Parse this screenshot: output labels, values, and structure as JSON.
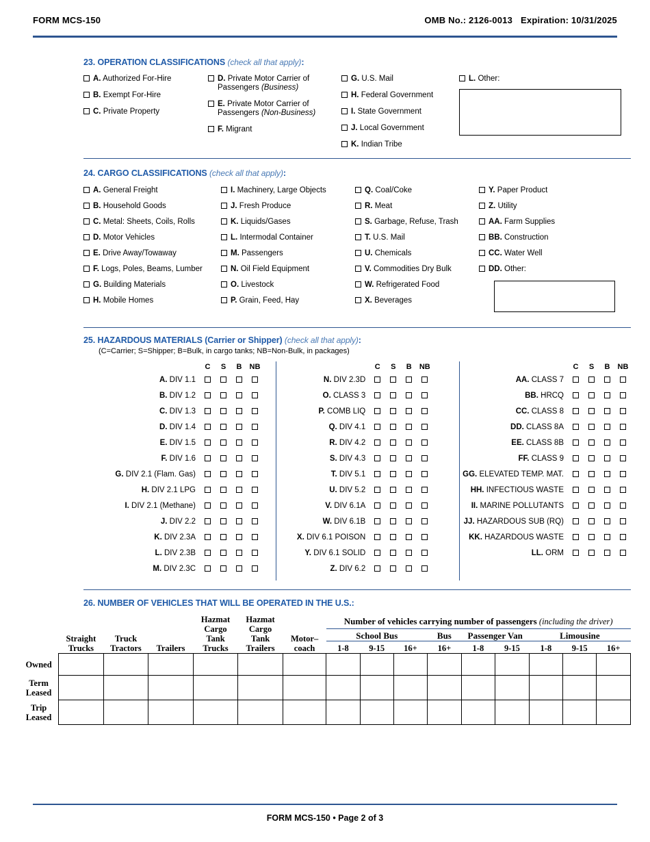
{
  "header": {
    "form_label": "FORM MCS-150",
    "omb": "OMB No.: 2126-0013",
    "expiration": "Expiration: 10/31/2025"
  },
  "footer": {
    "text": "FORM MCS-150 • Page 2 of 3"
  },
  "section23": {
    "number": "23.",
    "title": "OPERATION CLASSIFICATIONS",
    "hint": "(check all that apply)",
    "colon": ":",
    "col1": [
      {
        "letter": "A.",
        "label": "Authorized For-Hire"
      },
      {
        "letter": "B.",
        "label": "Exempt For-Hire"
      },
      {
        "letter": "C.",
        "label": "Private Property"
      }
    ],
    "col2": [
      {
        "letter": "D.",
        "label": "Private Motor Carrier of Passengers ",
        "em": "(Business)"
      },
      {
        "letter": "E.",
        "label": "Private Motor Carrier of Passengers ",
        "em": "(Non-Business)"
      },
      {
        "letter": "F.",
        "label": "Migrant",
        "em": ""
      }
    ],
    "col3": [
      {
        "letter": "G.",
        "label": "U.S. Mail"
      },
      {
        "letter": "H.",
        "label": "Federal Government"
      },
      {
        "letter": "I.",
        "label": "State Government"
      },
      {
        "letter": "J.",
        "label": "Local Government"
      },
      {
        "letter": "K.",
        "label": "Indian Tribe"
      }
    ],
    "other": {
      "letter": "L.",
      "label": "Other:",
      "value": ""
    }
  },
  "section24": {
    "number": "24.",
    "title": "CARGO CLASSIFICATIONS",
    "hint": "(check all that apply)",
    "colon": ":",
    "col1": [
      {
        "letter": "A.",
        "label": "General Freight"
      },
      {
        "letter": "B.",
        "label": "Household Goods"
      },
      {
        "letter": "C.",
        "label": "Metal: Sheets, Coils, Rolls"
      },
      {
        "letter": "D.",
        "label": "Motor Vehicles"
      },
      {
        "letter": "E.",
        "label": "Drive Away/Towaway"
      },
      {
        "letter": "F.",
        "label": "Logs, Poles, Beams, Lumber"
      },
      {
        "letter": "G.",
        "label": "Building Materials"
      },
      {
        "letter": "H.",
        "label": "Mobile Homes"
      }
    ],
    "col2": [
      {
        "letter": "I.",
        "label": "Machinery, Large Objects"
      },
      {
        "letter": "J.",
        "label": "Fresh Produce"
      },
      {
        "letter": "K.",
        "label": "Liquids/Gases"
      },
      {
        "letter": "L.",
        "label": "Intermodal Container"
      },
      {
        "letter": "M.",
        "label": "Passengers"
      },
      {
        "letter": "N.",
        "label": "Oil Field Equipment"
      },
      {
        "letter": "O.",
        "label": "Livestock"
      },
      {
        "letter": "P.",
        "label": "Grain, Feed, Hay"
      }
    ],
    "col3": [
      {
        "letter": "Q.",
        "label": "Coal/Coke"
      },
      {
        "letter": "R.",
        "label": "Meat"
      },
      {
        "letter": "S.",
        "label": "Garbage, Refuse, Trash"
      },
      {
        "letter": "T.",
        "label": "U.S. Mail"
      },
      {
        "letter": "U.",
        "label": "Chemicals"
      },
      {
        "letter": "V.",
        "label": "Commodities Dry Bulk"
      },
      {
        "letter": "W.",
        "label": "Refrigerated Food"
      },
      {
        "letter": "X.",
        "label": "Beverages"
      }
    ],
    "col4": [
      {
        "letter": "Y.",
        "label": "Paper Product"
      },
      {
        "letter": "Z.",
        "label": "Utility"
      },
      {
        "letter": "AA.",
        "label": "Farm Supplies"
      },
      {
        "letter": "BB.",
        "label": "Construction"
      },
      {
        "letter": "CC.",
        "label": "Water Well"
      },
      {
        "letter": "DD.",
        "label": "Other:"
      }
    ],
    "other_value": ""
  },
  "section25": {
    "number": "25.",
    "title": "HAZARDOUS MATERIALS (Carrier or Shipper)",
    "hint": "(check all that apply)",
    "colon": ":",
    "legend": "(C=Carrier; S=Shipper; B=Bulk, in cargo tanks; NB=Non-Bulk, in packages)",
    "columns": [
      "C",
      "S",
      "B",
      "NB"
    ],
    "col1": [
      {
        "letter": "A.",
        "label": "DIV 1.1"
      },
      {
        "letter": "B.",
        "label": "DIV 1.2"
      },
      {
        "letter": "C.",
        "label": "DIV 1.3"
      },
      {
        "letter": "D.",
        "label": "DIV 1.4"
      },
      {
        "letter": "E.",
        "label": "DIV 1.5"
      },
      {
        "letter": "F.",
        "label": "DIV 1.6"
      },
      {
        "letter": "G.",
        "label": "DIV 2.1 (Flam. Gas)"
      },
      {
        "letter": "H.",
        "label": "DIV 2.1 LPG"
      },
      {
        "letter": "I.",
        "label": "DIV 2.1 (Methane)"
      },
      {
        "letter": "J.",
        "label": "DIV 2.2"
      },
      {
        "letter": "K.",
        "label": "DIV 2.3A"
      },
      {
        "letter": "L.",
        "label": "DIV 2.3B"
      },
      {
        "letter": "M.",
        "label": "DIV 2.3C"
      }
    ],
    "col2": [
      {
        "letter": "N.",
        "label": "DIV 2.3D"
      },
      {
        "letter": "O.",
        "label": "CLASS 3"
      },
      {
        "letter": "P.",
        "label": "COMB LIQ"
      },
      {
        "letter": "Q.",
        "label": "DIV 4.1"
      },
      {
        "letter": "R.",
        "label": "DIV 4.2"
      },
      {
        "letter": "S.",
        "label": "DIV 4.3"
      },
      {
        "letter": "T.",
        "label": "DIV 5.1"
      },
      {
        "letter": "U.",
        "label": "DIV 5.2"
      },
      {
        "letter": "V.",
        "label": "DIV 6.1A"
      },
      {
        "letter": "W.",
        "label": "DIV 6.1B"
      },
      {
        "letter": "X.",
        "label": "DIV 6.1 POISON"
      },
      {
        "letter": "Y.",
        "label": "DIV 6.1 SOLID"
      },
      {
        "letter": "Z.",
        "label": "DIV 6.2"
      }
    ],
    "col3": [
      {
        "letter": "AA.",
        "label": "CLASS 7"
      },
      {
        "letter": "BB.",
        "label": "HRCQ"
      },
      {
        "letter": "CC.",
        "label": "CLASS 8"
      },
      {
        "letter": "DD.",
        "label": "CLASS 8A"
      },
      {
        "letter": "EE.",
        "label": "CLASS 8B"
      },
      {
        "letter": "FF.",
        "label": "CLASS 9"
      },
      {
        "letter": "GG.",
        "label": "ELEVATED TEMP. MAT."
      },
      {
        "letter": "HH.",
        "label": "INFECTIOUS WASTE"
      },
      {
        "letter": "II.",
        "label": "MARINE POLLUTANTS"
      },
      {
        "letter": "JJ.",
        "label": "HAZARDOUS SUB (RQ)"
      },
      {
        "letter": "KK.",
        "label": "HAZARDOUS WASTE"
      },
      {
        "letter": "LL.",
        "label": "ORM"
      }
    ]
  },
  "section26": {
    "number": "26.",
    "title": "NUMBER OF VEHICLES THAT WILL BE OPERATED IN THE U.S.:",
    "passenger_group_title": "Number of vehicles carrying number of passengers ",
    "passenger_group_em": "(including the driver)",
    "vehicle_columns": [
      {
        "l1": "",
        "l2": "Straight",
        "l3": "Trucks"
      },
      {
        "l1": "",
        "l2": "Truck",
        "l3": "Tractors"
      },
      {
        "l1": "",
        "l2": "",
        "l3": "Trailers"
      },
      {
        "l1": "Hazmat",
        "l2": "Cargo",
        "l3": "Tank",
        "l4": "Trucks"
      },
      {
        "l1": "Hazmat",
        "l2": "Cargo",
        "l3": "Tank",
        "l4": "Trailers"
      },
      {
        "l1": "",
        "l2": "Motor–",
        "l3": "coach"
      }
    ],
    "passenger_groups": [
      {
        "name": "School Bus",
        "sizes": [
          "1-8",
          "9-15",
          "16+"
        ]
      },
      {
        "name": "Bus",
        "sizes": [
          "16+"
        ]
      },
      {
        "name": "Passenger Van",
        "sizes": [
          "1-8",
          "9-15"
        ]
      },
      {
        "name": "Limousine",
        "sizes": [
          "1-8",
          "9-15",
          "16+"
        ]
      }
    ],
    "rows": [
      {
        "label1": "Owned",
        "label2": ""
      },
      {
        "label1": "Term",
        "label2": "Leased"
      },
      {
        "label1": "Trip",
        "label2": "Leased"
      }
    ]
  },
  "colors": {
    "accent_blue": "#2d5590",
    "heading_blue": "#1f5aa8",
    "hint_blue": "#4a7ab5"
  }
}
